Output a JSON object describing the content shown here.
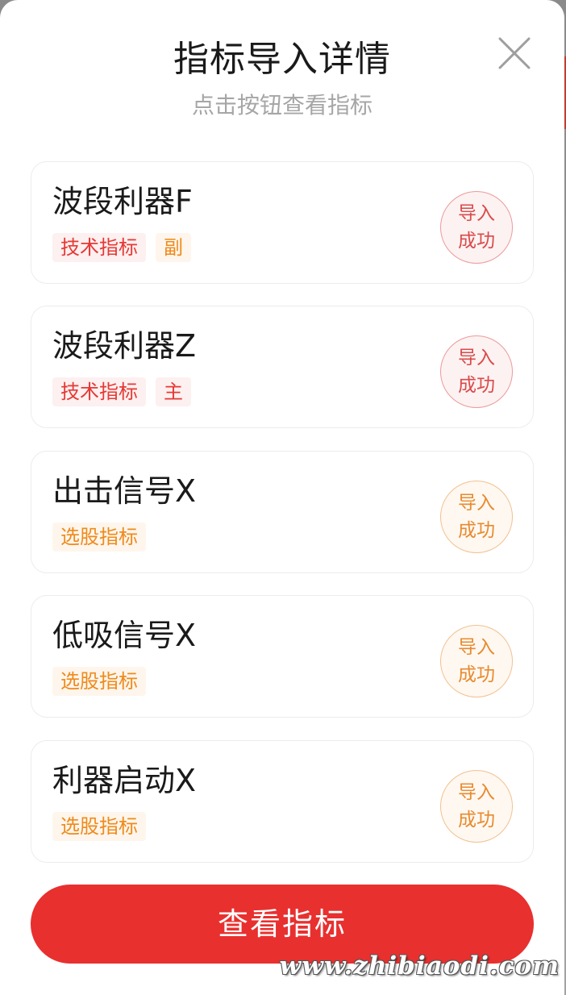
{
  "header": {
    "title": "指标导入详情",
    "subtitle": "点击按钮查看指标"
  },
  "close_icon": "close-icon",
  "items": [
    {
      "name": "波段利器F",
      "tags": [
        {
          "label": "技术指标",
          "color": "red"
        },
        {
          "label": "副",
          "color": "orange"
        }
      ],
      "status_line1": "导入",
      "status_line2": "成功",
      "status_color": "red"
    },
    {
      "name": "波段利器Z",
      "tags": [
        {
          "label": "技术指标",
          "color": "red"
        },
        {
          "label": "主",
          "color": "red"
        }
      ],
      "status_line1": "导入",
      "status_line2": "成功",
      "status_color": "red"
    },
    {
      "name": "出击信号X",
      "tags": [
        {
          "label": "选股指标",
          "color": "orange"
        }
      ],
      "status_line1": "导入",
      "status_line2": "成功",
      "status_color": "orange"
    },
    {
      "name": "低吸信号X",
      "tags": [
        {
          "label": "选股指标",
          "color": "orange"
        }
      ],
      "status_line1": "导入",
      "status_line2": "成功",
      "status_color": "orange"
    },
    {
      "name": "利器启动X",
      "tags": [
        {
          "label": "选股指标",
          "color": "orange"
        }
      ],
      "status_line1": "导入",
      "status_line2": "成功",
      "status_color": "orange"
    }
  ],
  "cta": {
    "label": "查看指标"
  },
  "watermark": "www.zhibiaodi.com",
  "colors": {
    "accent_red": "#e8302f",
    "tag_red": "#e53935",
    "tag_orange": "#ef8a1c"
  }
}
